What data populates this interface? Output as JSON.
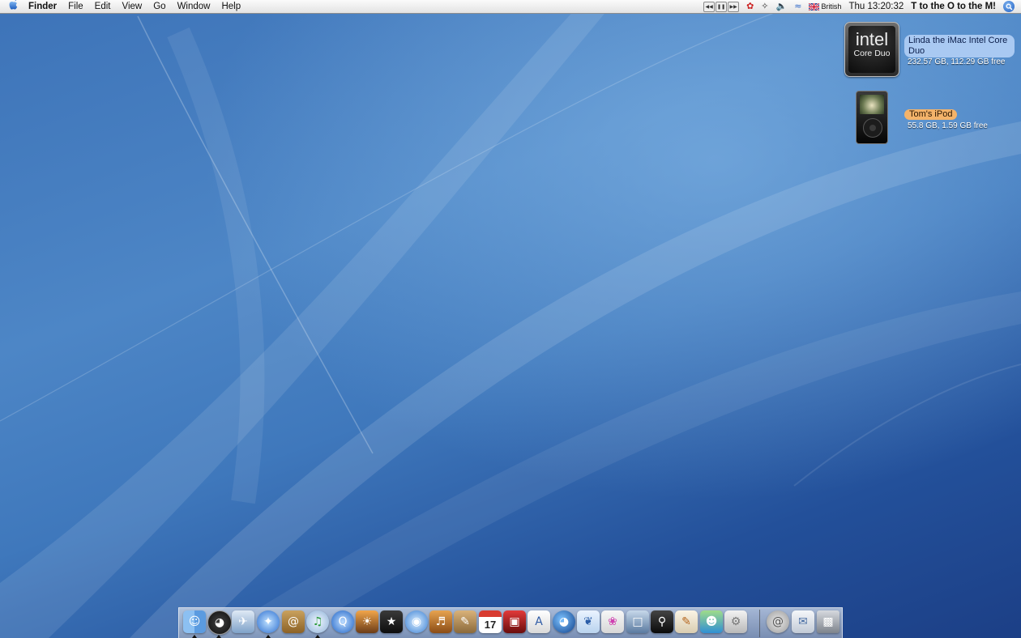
{
  "menubar": {
    "app_name": "Finder",
    "menus": [
      "File",
      "Edit",
      "View",
      "Go",
      "Window",
      "Help"
    ],
    "input_source": "British",
    "clock": "Thu 13:20:32",
    "user_name": "T to the O to the M!"
  },
  "desktop": {
    "items": [
      {
        "name": "Linda the iMac Intel Core Duo",
        "info": "232.57 GB, 112.29 GB free",
        "icon_text_1": "intel",
        "icon_text_2": "Core Duo",
        "label_color": "#a9c9f2"
      },
      {
        "name": "Tom's iPod",
        "info": "55.8 GB, 1.59 GB free",
        "label_color": "#f4b36a"
      }
    ]
  },
  "dock": {
    "ical_day": "17",
    "apps": [
      {
        "icon": "finder-icon",
        "running": true
      },
      {
        "icon": "dashboard-icon",
        "running": true
      },
      {
        "icon": "mail-icon",
        "running": false
      },
      {
        "icon": "safari-icon",
        "running": true
      },
      {
        "icon": "address-book-icon",
        "running": false
      },
      {
        "icon": "itunes-icon",
        "running": true
      },
      {
        "icon": "quicktime-icon",
        "running": false
      },
      {
        "icon": "iphoto-icon",
        "running": false
      },
      {
        "icon": "imovie-icon",
        "running": false
      },
      {
        "icon": "idvd-icon",
        "running": false
      },
      {
        "icon": "garageband-icon",
        "running": false
      },
      {
        "icon": "iweb-icon",
        "running": false
      },
      {
        "icon": "ical-icon",
        "running": false
      },
      {
        "icon": "photo-booth-icon",
        "running": false
      },
      {
        "icon": "textedit-icon",
        "running": false
      },
      {
        "icon": "google-earth-icon",
        "running": false
      },
      {
        "icon": "feather-app-icon",
        "running": false
      },
      {
        "icon": "butterfly-app-icon",
        "running": false
      },
      {
        "icon": "front-row-icon",
        "running": false
      },
      {
        "icon": "preview-icon",
        "running": false
      },
      {
        "icon": "script-editor-icon",
        "running": false
      },
      {
        "icon": "messenger-icon",
        "running": false
      },
      {
        "icon": "system-preferences-icon",
        "running": false
      }
    ],
    "right_items": [
      {
        "icon": "downloads-stack-icon"
      },
      {
        "icon": "documents-stack-icon"
      },
      {
        "icon": "trash-icon"
      }
    ]
  }
}
